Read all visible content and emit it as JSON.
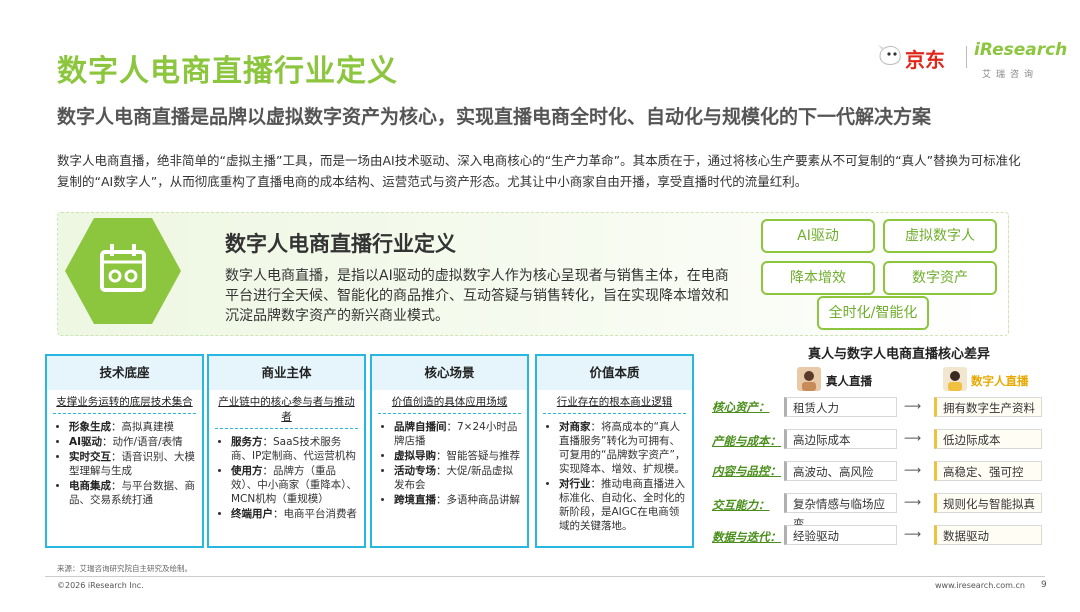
{
  "header": {
    "title": "数字人电商直播行业定义",
    "subtitle": "数字人电商直播是品牌以虚拟数字资产为核心，实现直播电商全时化、自动化与规模化的下一代解决方案",
    "logo_jd": "京东",
    "logo_iresearch": "iResearch",
    "logo_iresearch_sub": "艾瑞咨询"
  },
  "intro": "数字人电商直播，绝非简单的“虚拟主播”工具，而是一场由AI技术驱动、深入电商核心的“生产力革命”。其本质在于，通过将核心生产要素从不可复制的“真人”替换为可标准化复制的“AI数字人”，从而彻底重构了直播电商的成本结构、运营范式与资产形态。尤其让中小商家自由开播，享受直播时代的流量红利。",
  "definition": {
    "title": "数字人电商直播行业定义",
    "body": "数字人电商直播，是指以AI驱动的虚拟数字人作为核心呈现者与销售主体，在电商平台进行全天候、智能化的商品推介、互动答疑与销售转化，旨在实现降本增效和沉淀品牌数字资产的新兴商业模式。",
    "icon": "calendar-robot-icon",
    "tags": [
      "AI驱动",
      "虚拟数字人",
      "降本增效",
      "数字资产",
      "全时化/智能化"
    ]
  },
  "cards": [
    {
      "title": "技术底座",
      "subtitle": "支撑业务运转的底层技术集合",
      "items": [
        {
          "k": "形象生成",
          "v": "：高拟真建模"
        },
        {
          "k": "AI驱动",
          "v": "：动作/语音/表情"
        },
        {
          "k": "实时交互",
          "v": "：语音识别、大模型理解与生成"
        },
        {
          "k": "电商集成",
          "v": "：与平台数据、商品、交易系统打通"
        }
      ]
    },
    {
      "title": "商业主体",
      "subtitle": "产业链中的核心参与者与推动者",
      "items": [
        {
          "k": "服务方",
          "v": "：SaaS技术服务商、IP定制商、代运营机构"
        },
        {
          "k": "使用方",
          "v": "：品牌方（重品效）、中小商家（重降本）、MCN机构（重规模）"
        },
        {
          "k": "终端用户",
          "v": "：电商平台消费者"
        }
      ]
    },
    {
      "title": "核心场景",
      "subtitle": "价值创造的具体应用场域",
      "items": [
        {
          "k": "品牌自播间",
          "v": "：7×24小时品牌店播"
        },
        {
          "k": "虚拟导购",
          "v": "：智能答疑与推荐"
        },
        {
          "k": "活动专场",
          "v": "：大促/新品虚拟发布会"
        },
        {
          "k": "跨境直播",
          "v": "：多语种商品讲解"
        }
      ]
    },
    {
      "title": "价值本质",
      "subtitle": "行业存在的根本商业逻辑",
      "items": [
        {
          "k": "对商家",
          "v": "：将高成本的“真人直播服务”转化为可拥有、可复用的“品牌数字资产”，实现降本、增效、扩规模。"
        },
        {
          "k": "对行业",
          "v": "：推动电商直播进入标准化、自动化、全时化的新阶段，是AIGC在电商领域的关键落地。"
        }
      ]
    }
  ],
  "comparison": {
    "title": "真人与数字人电商直播核心差异",
    "real_label": "真人直播",
    "digital_label": "数字人直播",
    "rows": [
      {
        "label": "核心资产：",
        "real": "租赁人力",
        "digital": "拥有数字生产资料"
      },
      {
        "label": "产能与成本：",
        "real": "高边际成本",
        "digital": "低边际成本"
      },
      {
        "label": "内容与品控：",
        "real": "高波动、高风险",
        "digital": "高稳定、强可控"
      },
      {
        "label": "交互能力：",
        "real": "复杂情感与临场应变",
        "digital": "规则化与智能拟真"
      },
      {
        "label": "数据与迭代：",
        "real": "经验驱动",
        "digital": "数据驱动"
      }
    ]
  },
  "footer": {
    "source": "来源：艾瑞咨询研究院自主研究及绘制。",
    "copyright": "©2026 iResearch Inc.",
    "site": "www.iresearch.com.cn",
    "page": "9"
  },
  "colors": {
    "accent_green": "#8cc63f",
    "card_blue": "#28b7e0",
    "jd_red": "#e0261a"
  }
}
